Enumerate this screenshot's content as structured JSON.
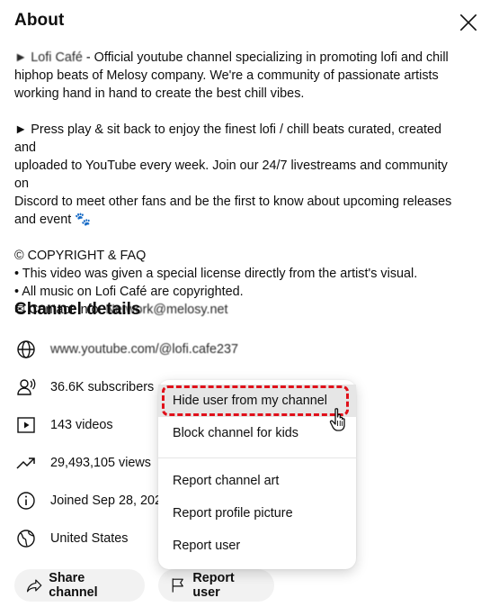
{
  "about": {
    "title": "About",
    "close_icon": "close-icon",
    "description": {
      "line1_prefix": "► Lofi Café",
      "line1_rest": " - Official youtube channel specializing in promoting lofi and chill",
      "line2": "hiphop beats of Melosy company. We're a community of passionate artists",
      "line3": "working hand in hand to create the best chill vibes.",
      "para2_line1": "► Press play & sit back to enjoy the finest lofi / chill beats curated, created and",
      "para2_line2": "uploaded to YouTube every week. Join our 24/7 livestreams and community on",
      "para2_line3": "Discord to meet other fans and be the first to know about upcoming releases",
      "para2_line4": "and event",
      "para2_emoji": "🐾",
      "copyright": "© COPYRIGHT & FAQ",
      "bullet1": "• This video was given a special license directly from the artist's visual.",
      "bullet2": "• All music on Lofi Café are copyrighted.",
      "contact_label": "✉ Contact Info.",
      "contact_value": "Network@melosy.net"
    }
  },
  "channel_details": {
    "title": "Channel details",
    "url": "www.youtube.com/@lofi.cafe237",
    "subscribers": "36.6K subscribers",
    "videos": "143 videos",
    "views": "29,493,105 views",
    "joined": "Joined Sep 28, 2021",
    "country": "United States"
  },
  "buttons": {
    "share": "Share channel",
    "report": "Report user"
  },
  "menu": {
    "hide_user": "Hide user from my channel",
    "block_kids": "Block channel for kids",
    "report_art": "Report channel art",
    "report_picture": "Report profile picture",
    "report_user": "Report user"
  },
  "colors": {
    "highlight_border": "#e0101a",
    "hover_bg": "#e6e6e6",
    "pill_bg": "#f2f2f2"
  }
}
